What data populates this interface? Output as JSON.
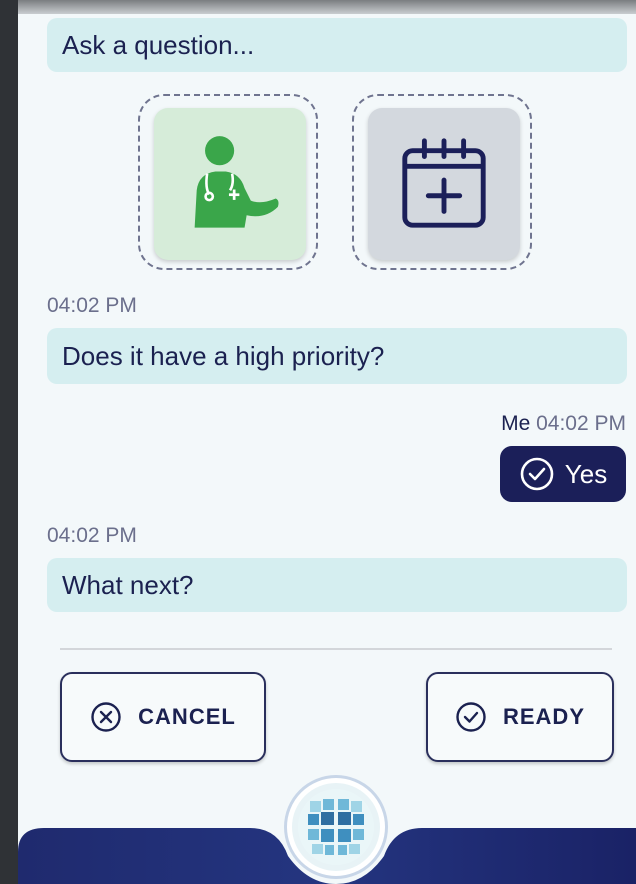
{
  "input": {
    "placeholder": "Ask a question..."
  },
  "tiles": [
    {
      "name": "doctor",
      "icon": "doctor-icon",
      "bg": "#d6ecd9",
      "icon_color": "#3aa64a"
    },
    {
      "name": "calendar",
      "icon": "calendar-add-icon",
      "bg": "#d3d8de",
      "icon_color": "#1b1f59"
    }
  ],
  "messages": [
    {
      "time": "04:02 PM",
      "text": "Does it have a high priority?"
    },
    {
      "time": "04:02 PM",
      "text": "What next?"
    }
  ],
  "reply": {
    "author": "Me",
    "time": "04:02 PM",
    "text": "Yes"
  },
  "actions": {
    "cancel": "CANCEL",
    "ready": "READY"
  },
  "colors": {
    "accent": "#1b1f59",
    "bubble": "#d5eef0",
    "nav": "#1f2a6e"
  }
}
